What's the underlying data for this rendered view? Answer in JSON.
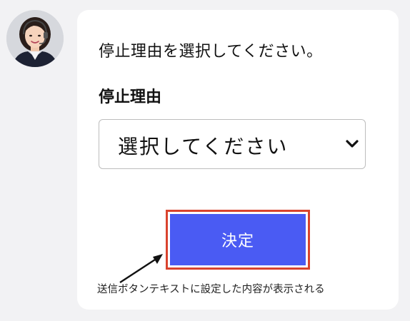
{
  "prompt": "停止理由を選択してください。",
  "field": {
    "label": "停止理由",
    "selected_value": "選択してください"
  },
  "submit_label": "決定",
  "annotation": "送信ボタンテキストに設定した内容が表示される",
  "icons": {
    "avatar": "operator-avatar-icon",
    "dropdown": "chevron-down-icon",
    "pointer": "arrow-icon"
  },
  "colors": {
    "button": "#4a5bf3",
    "highlight_border": "#d9432e",
    "page_background": "#f2f2f4",
    "card_background": "#ffffff"
  }
}
